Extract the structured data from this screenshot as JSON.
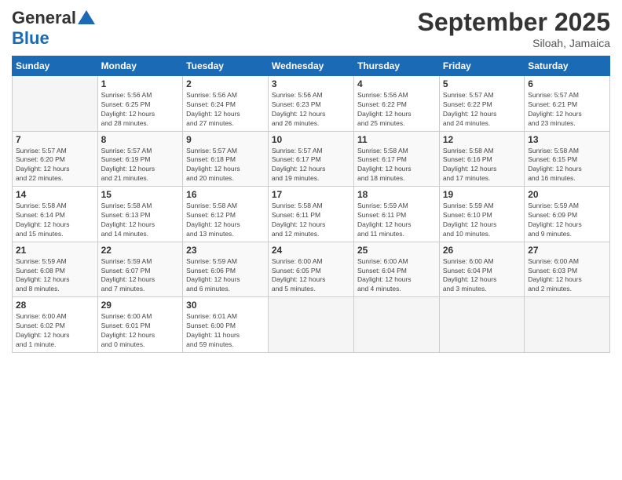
{
  "header": {
    "logo_line1": "General",
    "logo_line2": "Blue",
    "month": "September 2025",
    "location": "Siloah, Jamaica"
  },
  "days_of_week": [
    "Sunday",
    "Monday",
    "Tuesday",
    "Wednesday",
    "Thursday",
    "Friday",
    "Saturday"
  ],
  "weeks": [
    [
      {
        "day": "",
        "info": ""
      },
      {
        "day": "1",
        "info": "Sunrise: 5:56 AM\nSunset: 6:25 PM\nDaylight: 12 hours\nand 28 minutes."
      },
      {
        "day": "2",
        "info": "Sunrise: 5:56 AM\nSunset: 6:24 PM\nDaylight: 12 hours\nand 27 minutes."
      },
      {
        "day": "3",
        "info": "Sunrise: 5:56 AM\nSunset: 6:23 PM\nDaylight: 12 hours\nand 26 minutes."
      },
      {
        "day": "4",
        "info": "Sunrise: 5:56 AM\nSunset: 6:22 PM\nDaylight: 12 hours\nand 25 minutes."
      },
      {
        "day": "5",
        "info": "Sunrise: 5:57 AM\nSunset: 6:22 PM\nDaylight: 12 hours\nand 24 minutes."
      },
      {
        "day": "6",
        "info": "Sunrise: 5:57 AM\nSunset: 6:21 PM\nDaylight: 12 hours\nand 23 minutes."
      }
    ],
    [
      {
        "day": "7",
        "info": "Sunrise: 5:57 AM\nSunset: 6:20 PM\nDaylight: 12 hours\nand 22 minutes."
      },
      {
        "day": "8",
        "info": "Sunrise: 5:57 AM\nSunset: 6:19 PM\nDaylight: 12 hours\nand 21 minutes."
      },
      {
        "day": "9",
        "info": "Sunrise: 5:57 AM\nSunset: 6:18 PM\nDaylight: 12 hours\nand 20 minutes."
      },
      {
        "day": "10",
        "info": "Sunrise: 5:57 AM\nSunset: 6:17 PM\nDaylight: 12 hours\nand 19 minutes."
      },
      {
        "day": "11",
        "info": "Sunrise: 5:58 AM\nSunset: 6:17 PM\nDaylight: 12 hours\nand 18 minutes."
      },
      {
        "day": "12",
        "info": "Sunrise: 5:58 AM\nSunset: 6:16 PM\nDaylight: 12 hours\nand 17 minutes."
      },
      {
        "day": "13",
        "info": "Sunrise: 5:58 AM\nSunset: 6:15 PM\nDaylight: 12 hours\nand 16 minutes."
      }
    ],
    [
      {
        "day": "14",
        "info": "Sunrise: 5:58 AM\nSunset: 6:14 PM\nDaylight: 12 hours\nand 15 minutes."
      },
      {
        "day": "15",
        "info": "Sunrise: 5:58 AM\nSunset: 6:13 PM\nDaylight: 12 hours\nand 14 minutes."
      },
      {
        "day": "16",
        "info": "Sunrise: 5:58 AM\nSunset: 6:12 PM\nDaylight: 12 hours\nand 13 minutes."
      },
      {
        "day": "17",
        "info": "Sunrise: 5:58 AM\nSunset: 6:11 PM\nDaylight: 12 hours\nand 12 minutes."
      },
      {
        "day": "18",
        "info": "Sunrise: 5:59 AM\nSunset: 6:11 PM\nDaylight: 12 hours\nand 11 minutes."
      },
      {
        "day": "19",
        "info": "Sunrise: 5:59 AM\nSunset: 6:10 PM\nDaylight: 12 hours\nand 10 minutes."
      },
      {
        "day": "20",
        "info": "Sunrise: 5:59 AM\nSunset: 6:09 PM\nDaylight: 12 hours\nand 9 minutes."
      }
    ],
    [
      {
        "day": "21",
        "info": "Sunrise: 5:59 AM\nSunset: 6:08 PM\nDaylight: 12 hours\nand 8 minutes."
      },
      {
        "day": "22",
        "info": "Sunrise: 5:59 AM\nSunset: 6:07 PM\nDaylight: 12 hours\nand 7 minutes."
      },
      {
        "day": "23",
        "info": "Sunrise: 5:59 AM\nSunset: 6:06 PM\nDaylight: 12 hours\nand 6 minutes."
      },
      {
        "day": "24",
        "info": "Sunrise: 6:00 AM\nSunset: 6:05 PM\nDaylight: 12 hours\nand 5 minutes."
      },
      {
        "day": "25",
        "info": "Sunrise: 6:00 AM\nSunset: 6:04 PM\nDaylight: 12 hours\nand 4 minutes."
      },
      {
        "day": "26",
        "info": "Sunrise: 6:00 AM\nSunset: 6:04 PM\nDaylight: 12 hours\nand 3 minutes."
      },
      {
        "day": "27",
        "info": "Sunrise: 6:00 AM\nSunset: 6:03 PM\nDaylight: 12 hours\nand 2 minutes."
      }
    ],
    [
      {
        "day": "28",
        "info": "Sunrise: 6:00 AM\nSunset: 6:02 PM\nDaylight: 12 hours\nand 1 minute."
      },
      {
        "day": "29",
        "info": "Sunrise: 6:00 AM\nSunset: 6:01 PM\nDaylight: 12 hours\nand 0 minutes."
      },
      {
        "day": "30",
        "info": "Sunrise: 6:01 AM\nSunset: 6:00 PM\nDaylight: 11 hours\nand 59 minutes."
      },
      {
        "day": "",
        "info": ""
      },
      {
        "day": "",
        "info": ""
      },
      {
        "day": "",
        "info": ""
      },
      {
        "day": "",
        "info": ""
      }
    ]
  ]
}
